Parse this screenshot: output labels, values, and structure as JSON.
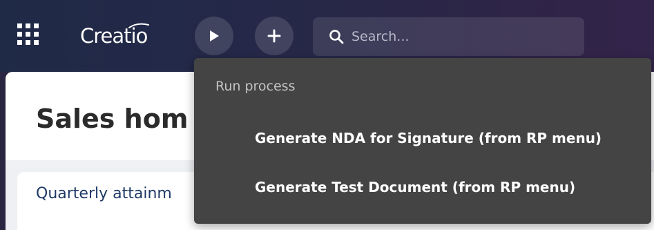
{
  "header": {
    "logo_text": "Creatio",
    "search": {
      "placeholder": "Search..."
    },
    "icons": {
      "app_grid": "apps-grid-icon",
      "run_process": "play-icon",
      "add": "plus-icon",
      "search": "search-icon"
    },
    "colors": {
      "header_bg": "#262848",
      "button_bg": "#3a3a55",
      "menu_bg": "#444444"
    }
  },
  "main": {
    "page_title": "Sales hom",
    "widget_title": "Quarterly attainm"
  },
  "run_process_menu": {
    "header": "Run process",
    "items": [
      {
        "label": "Generate NDA for Signature (from RP menu)"
      },
      {
        "label": "Generate Test Document (from RP menu)"
      }
    ]
  }
}
